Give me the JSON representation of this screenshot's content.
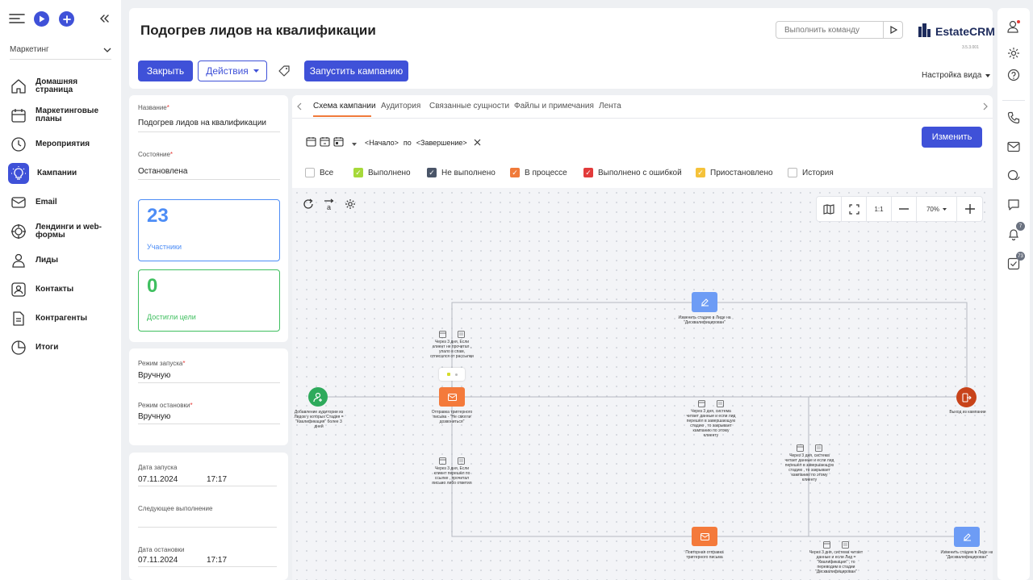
{
  "nav": {
    "module": "Маркетинг",
    "items": [
      {
        "label": "Домашняя страница",
        "icon": "home-icon"
      },
      {
        "label": "Маркетинговые планы",
        "icon": "calendar-icon"
      },
      {
        "label": "Мероприятия",
        "icon": "clock-icon"
      },
      {
        "label": "Кампании",
        "icon": "lightbulb-icon"
      },
      {
        "label": "Email",
        "icon": "email-icon"
      },
      {
        "label": "Лендинги и web-формы",
        "icon": "target-icon"
      },
      {
        "label": "Лиды",
        "icon": "lead-icon"
      },
      {
        "label": "Контакты",
        "icon": "contact-icon"
      },
      {
        "label": "Контрагенты",
        "icon": "document-icon"
      },
      {
        "label": "Итоги",
        "icon": "pie-chart-icon"
      }
    ]
  },
  "header": {
    "title": "Подогрев лидов на квалификации",
    "command_placeholder": "Выполнить команду",
    "logo_text": "EstateCRM",
    "version": "3.5.3.001",
    "close_label": "Закрыть",
    "actions_label": "Действия",
    "launch_label": "Запустить кампанию",
    "view_settings": "Настройка вида"
  },
  "details": {
    "name_label": "Название",
    "name_value": "Подогрев лидов на квалификации",
    "state_label": "Состояние",
    "state_value": "Остановлена",
    "participants_count": "23",
    "participants_label": "Участники",
    "goal_count": "0",
    "goal_label": "Достигли цели",
    "launch_mode_label": "Режим запуска",
    "launch_mode_value": "Вручную",
    "stop_mode_label": "Режим остановки",
    "stop_mode_value": "Вручную",
    "launch_date_label": "Дата запуска",
    "launch_date": "07.11.2024",
    "launch_time": "17:17",
    "next_run_label": "Следующее выполнение",
    "stop_date_label": "Дата остановки",
    "stop_date": "07.11.2024",
    "stop_time": "17:17"
  },
  "tabs": [
    {
      "label": "Схема кампании",
      "active": true
    },
    {
      "label": "Аудитория"
    },
    {
      "label": "Связанные сущности"
    },
    {
      "label": "Файлы и примечания"
    },
    {
      "label": "Лента"
    }
  ],
  "period": {
    "start": "<Начало>",
    "by": "по",
    "end": "<Завершение>"
  },
  "edit_label": "Изменить",
  "filters": [
    {
      "label": "Все",
      "color": "#ffffff",
      "checked": false
    },
    {
      "label": "Выполнено",
      "color": "#a6d93a",
      "checked": true
    },
    {
      "label": "Не выполнено",
      "color": "#4a5568",
      "checked": true
    },
    {
      "label": "В процессе",
      "color": "#f07a3a",
      "checked": true
    },
    {
      "label": "Выполнено с ошибкой",
      "color": "#e23b3b",
      "checked": true
    },
    {
      "label": "Приостановлено",
      "color": "#f5c23a",
      "checked": true
    },
    {
      "label": "История",
      "color": "#ffffff",
      "checked": false
    }
  ],
  "zoom": {
    "ratio_label": "1:1",
    "level": "70%"
  },
  "flow": {
    "nodes": {
      "start": "Добавление аудитории из Лидов у которых Стадия = \"Квалификация\" более 3 дней",
      "email1": "Отправка триггерного письма - \"Не смогли дозвониться\"",
      "stage_top": "Изменить стадию в Лиде на \"Дисквалифицирован\"",
      "exit": "Выход из кампании",
      "email2": "Повторная отправка триггерного письма",
      "stage_bottom": "Изменить стадию в Лиде на \"Дисквалифицирован\""
    },
    "conditions": {
      "c1": "Через 3 дня, Если клиент не прочитал , упало в спам, отписался от рассылки",
      "c2": "Через 3 дня, Если клиент перешёл по ссылке , прочитал письмо либо ответил",
      "c3": "Через 3 дня, система читает данные и если лид перешёл в завершающую стадию , то закрывает кампанию по этому клиенту",
      "c4": "Через 3 дня, система читает данные и если лид перешёл в завершающую стадию , то закрывает кампанию по этому клиенту",
      "c5": "Через 3 дня, система читает данные и если Лид = \"Квалификация\" , то переводим в стадии \"Дисквалифицирован\""
    }
  },
  "right_rail": {
    "notifications_count": "7",
    "tasks_count": "73"
  },
  "colors": {
    "primary": "#3f51d8",
    "start_node": "#2eaa5c",
    "email_node": "#f47a3b",
    "stage_node": "#6d9cf5",
    "exit_node": "#c8431a",
    "participants_border": "#4d8df6",
    "goal_border": "#3fbf5f"
  }
}
